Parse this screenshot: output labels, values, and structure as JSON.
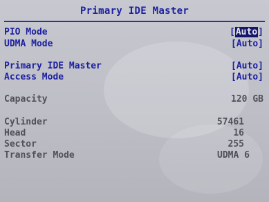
{
  "title": "Primary IDE Master",
  "options": [
    {
      "label": "PIO Mode",
      "value": "Auto",
      "selected": true
    },
    {
      "label": "UDMA Mode",
      "value": "Auto",
      "selected": false
    },
    {
      "label": "Primary IDE Master",
      "value": "Auto",
      "selected": false
    },
    {
      "label": "Access Mode",
      "value": "Auto",
      "selected": false
    }
  ],
  "info": [
    {
      "label": "Capacity",
      "value": "120 GB"
    },
    {
      "label": "Cylinder",
      "value": "57461"
    },
    {
      "label": "Head",
      "value": "16"
    },
    {
      "label": "Sector",
      "value": "255"
    },
    {
      "label": "Transfer Mode",
      "value": "UDMA 6"
    }
  ],
  "colors": {
    "text_blue": "#1c1fa0",
    "text_gray": "#505058",
    "highlight": "#14156b",
    "background": "#c7c8d0"
  }
}
